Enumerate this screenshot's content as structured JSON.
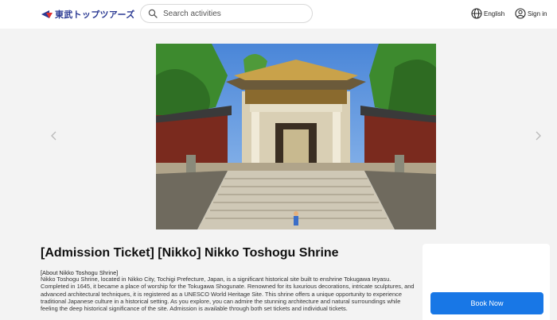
{
  "header": {
    "logo_text": "東武トップツアーズ",
    "search_placeholder": "Search activities",
    "language_label": "English",
    "signin_label": "Sign in"
  },
  "gallery": {
    "prev_icon": "chevron-left-icon",
    "next_icon": "chevron-right-icon"
  },
  "product": {
    "title": "[Admission Ticket] [Nikko] Nikko Toshogu Shrine",
    "about_heading": "[About Nikko Toshogu Shrine]",
    "description": "Nikko Toshogu Shrine, located in Nikko City, Tochigi Prefecture, Japan, is a significant historical site built to enshrine Tokugawa Ieyasu. Completed in 1645, it became a place of worship for the Tokugawa Shogunate. Renowned for its luxurious decorations, intricate sculptures, and advanced architectural techniques, it is registered as a UNESCO World Heritage Site. This shrine offers a unique opportunity to experience traditional Japanese culture in a historical setting. As you explore, you can admire the stunning architecture and natural surroundings while feeling the deep historical significance of the site. Admission is available through both set tickets and individual tickets."
  },
  "booking": {
    "button_label": "Book Now"
  },
  "colors": {
    "brand_blue": "#2b3a93",
    "brand_red": "#e03030",
    "button_blue": "#1877e6",
    "page_bg": "#f3f3f3"
  }
}
